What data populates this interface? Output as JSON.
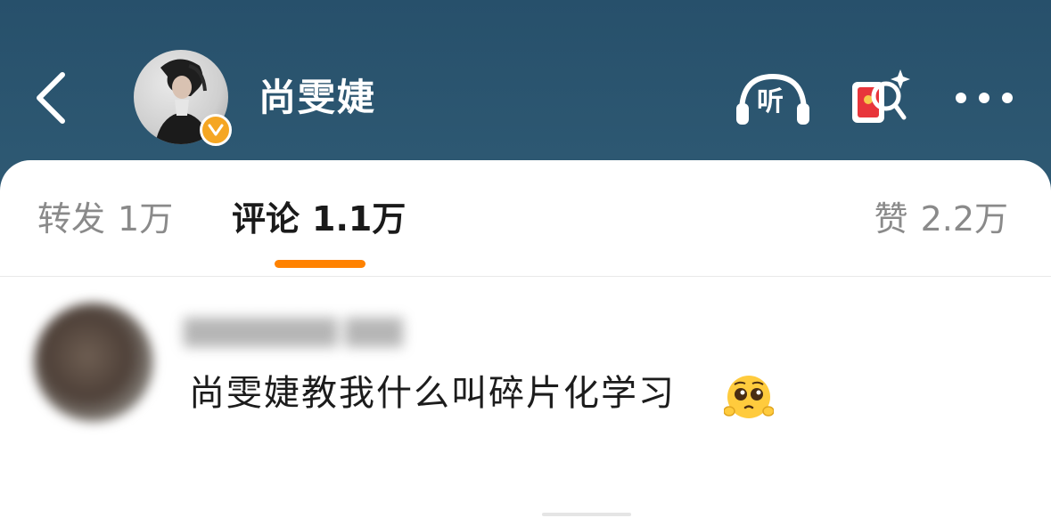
{
  "header": {
    "user_name": "尚雯婕",
    "listen_label": "听",
    "icons": [
      "back-arrow-icon",
      "verified-badge-icon",
      "headphones-icon",
      "red-envelope-search-icon",
      "more-dots-icon"
    ],
    "colors": {
      "background": "#2c5672",
      "verified": "#f5a623"
    }
  },
  "tabs": [
    {
      "label": "转发",
      "count": "1万",
      "active": false
    },
    {
      "label": "评论",
      "count": "1.1万",
      "active": true
    },
    {
      "label": "赞",
      "count": "2.2万",
      "active": false
    }
  ],
  "accent_color": "#ff8200",
  "comment": {
    "text": "尚雯婕教我什么叫碎片化学习",
    "emoji": "pleading-face-emoji"
  }
}
